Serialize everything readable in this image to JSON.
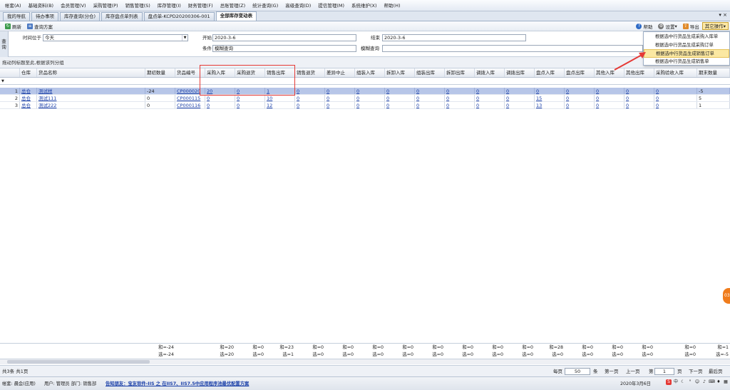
{
  "menubar": {
    "items": [
      "帐套(A)",
      "基础资料(B)",
      "会员管理(V)",
      "采购管理(P)",
      "销售管理(S)",
      "库存管理(I)",
      "财务管理(F)",
      "总账管理(Z)",
      "统计查询(G)",
      "高级查询(D)",
      "提信管理(M)",
      "系统维护(X)",
      "帮助(H)"
    ]
  },
  "tabs": [
    "我的导航",
    "待办事项",
    "库存查询(分仓)",
    "库存盘点单列表",
    "盘点单-KCPD20200306-001",
    "全部库存变动表"
  ],
  "tab_controls": "▾ ×",
  "toolbar": {
    "refresh": "刷新",
    "query_scheme": "查询方案",
    "help": "帮助",
    "settings": "设置",
    "export": "导出",
    "more_ops": "其它操作"
  },
  "dropdown": {
    "items": [
      "根据选中行货品生成采购入库单",
      "根据选中行货品生成采购订单",
      "根据选中行货品生成销售订单",
      "根据选中行货品生成销售单"
    ]
  },
  "query": {
    "side_label": "查询",
    "time_label": "时间位于",
    "time_value": "今天",
    "start_label": "开始",
    "start_value": "2020-3-6",
    "end_label": "结束",
    "end_value": "2020-3-6",
    "cond_label": "条件",
    "cond_value": "模糊查询",
    "fuzzy_label": "模糊查询",
    "fuzzy_value": ""
  },
  "group_hint": "拖动列标题至此,根据该列分组",
  "grid": {
    "columns": [
      "",
      "仓库",
      "货品名称",
      "期初数量",
      "货品编号",
      "采购入库",
      "采购退货",
      "销售出库",
      "销售退货",
      "差异中止",
      "组装入库",
      "拆卸入库",
      "组装出库",
      "拆卸出库",
      "调拨入库",
      "调拨出库",
      "盘点入库",
      "盘点出库",
      "其他入库",
      "其他出库",
      "采购验收入库",
      "期末数量"
    ],
    "rows": [
      {
        "no": "1",
        "cells": [
          "总仓",
          "测试样",
          "-24",
          "CP000020",
          "20",
          "0",
          "1",
          "0",
          "0",
          "0",
          "0",
          "0",
          "0",
          "0",
          "0",
          "0",
          "0",
          "0",
          "0",
          "0",
          "-5"
        ]
      },
      {
        "no": "2",
        "cells": [
          "总仓",
          "测试111",
          "0",
          "CP000115",
          "0",
          "0",
          "10",
          "0",
          "0",
          "0",
          "0",
          "0",
          "0",
          "0",
          "0",
          "15",
          "0",
          "0",
          "0",
          "0",
          "5"
        ]
      },
      {
        "no": "3",
        "cells": [
          "总仓",
          "测试222",
          "0",
          "CP000116",
          "0",
          "0",
          "12",
          "0",
          "0",
          "0",
          "0",
          "0",
          "0",
          "0",
          "0",
          "13",
          "0",
          "0",
          "0",
          "0",
          "1"
        ]
      }
    ],
    "summary_sum": [
      "和=-24",
      "",
      "和=20",
      "和=0",
      "和=23",
      "和=0",
      "和=0",
      "和=0",
      "和=0",
      "和=0",
      "和=0",
      "和=0",
      "和=0",
      "和=28",
      "和=0",
      "和=0",
      "和=0",
      "和=0",
      "和=1"
    ],
    "summary_sel": [
      "选=-24",
      "",
      "选=20",
      "选=0",
      "选=1",
      "选=0",
      "选=0",
      "选=0",
      "选=0",
      "选=0",
      "选=0",
      "选=0",
      "选=0",
      "选=0",
      "选=0",
      "选=0",
      "选=0",
      "选=0",
      "选=-5"
    ]
  },
  "pager": {
    "total": "共3条  共1页",
    "per_page_label": "每页",
    "per_page": "50",
    "unit": "条",
    "first": "第一页",
    "prev": "上一页",
    "page_label": "第",
    "page": "1",
    "page_unit": "页",
    "next": "下一页",
    "last": "最后页"
  },
  "status": {
    "account": "帐套: 晨会(应用)",
    "user": "用户: 管理员  部门: 销售部",
    "notice": "告知朋友：宝友软件-IIS 之 在IIS7、IIS7.5中应用程序池最优配置方案",
    "date": "2020年3月6日",
    "side_bubble": "03"
  },
  "colors": {
    "accent": "#1a3fa8",
    "highlight": "#e53935",
    "selected_row": "#b7c6e8",
    "dropdown_highlight": "#fbe8a2"
  }
}
